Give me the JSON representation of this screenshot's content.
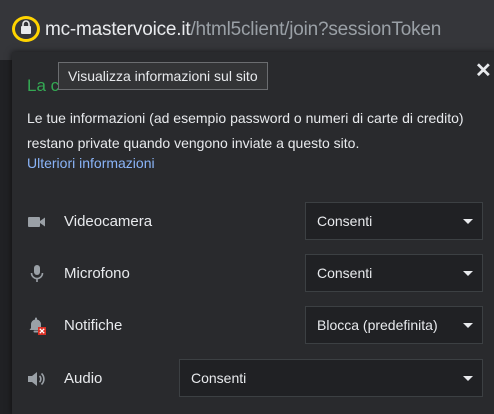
{
  "urlbar": {
    "host": "mc-mastervoice.it",
    "path": "/html5client/join?sessionToken",
    "lock_icon": "lock-icon",
    "highlight_color": "#ffd400"
  },
  "tooltip": {
    "text": "Visualizza informazioni sul sito"
  },
  "panel": {
    "title_partial": "La c",
    "description": "Le tue informazioni (ad esempio password o numeri di carte di credito) restano private quando vengono inviate a questo sito.",
    "more_link": "Ulteriori informazioni",
    "close_icon": "close-icon",
    "accent_color": "#34a853",
    "link_color": "#8ab4f8"
  },
  "permissions": [
    {
      "name": "camera",
      "label": "Videocamera",
      "value": "Consenti",
      "icon": "camera-icon"
    },
    {
      "name": "microphone",
      "label": "Microfono",
      "value": "Consenti",
      "icon": "microphone-icon"
    },
    {
      "name": "notifications",
      "label": "Notifiche",
      "value": "Blocca (predefinita)",
      "icon": "notifications-blocked-icon"
    },
    {
      "name": "audio",
      "label": "Audio",
      "value": "Consenti",
      "icon": "speaker-icon"
    }
  ]
}
